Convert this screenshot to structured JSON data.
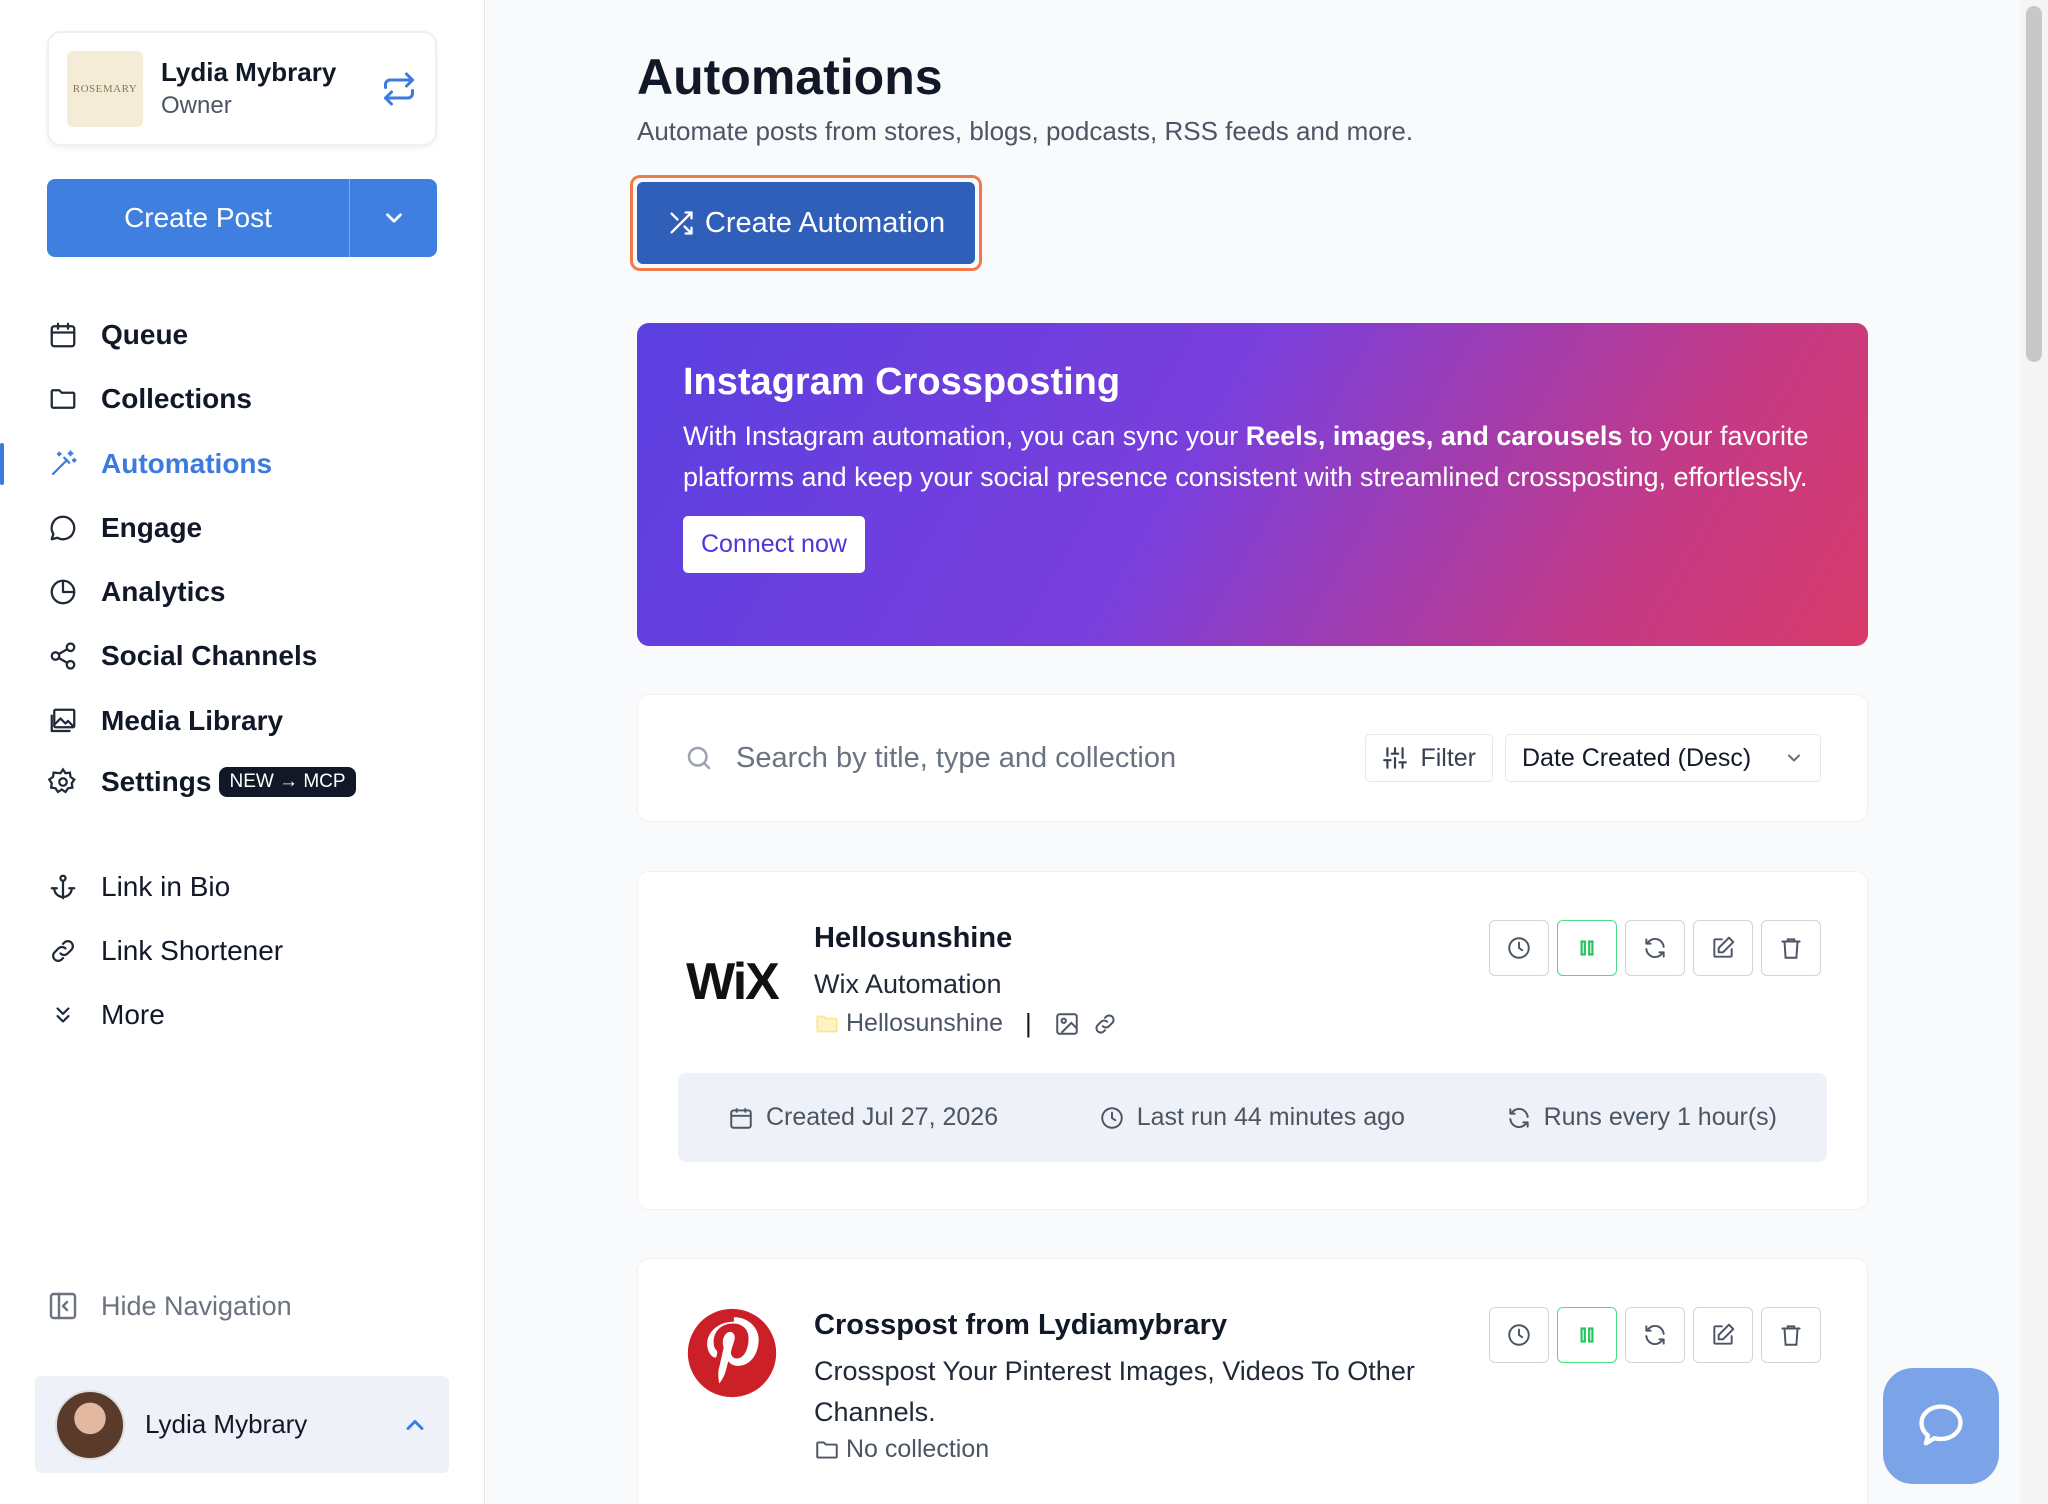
{
  "workspace": {
    "name": "Lydia Mybrary",
    "role": "Owner",
    "logo_text": "ROSEMARY"
  },
  "create_post": {
    "label": "Create Post"
  },
  "nav": {
    "primary": [
      {
        "label": "Queue",
        "icon": "calendar-icon"
      },
      {
        "label": "Collections",
        "icon": "folder-icon"
      },
      {
        "label": "Automations",
        "icon": "wand-icon",
        "active": true
      },
      {
        "label": "Engage",
        "icon": "chat-bubble-icon"
      },
      {
        "label": "Analytics",
        "icon": "pie-chart-icon"
      },
      {
        "label": "Social Channels",
        "icon": "share-icon"
      },
      {
        "label": "Media Library",
        "icon": "images-icon"
      },
      {
        "label": "Settings",
        "icon": "gear-icon",
        "badge": "NEW → MCP"
      }
    ],
    "secondary": [
      {
        "label": "Link in Bio",
        "icon": "anchor-icon"
      },
      {
        "label": "Link Shortener",
        "icon": "link-icon"
      },
      {
        "label": "More",
        "icon": "chevrons-down-icon"
      }
    ],
    "hide_label": "Hide Navigation"
  },
  "user": {
    "name": "Lydia Mybrary"
  },
  "page": {
    "title": "Automations",
    "subtitle": "Automate posts from stores, blogs, podcasts, RSS feeds and more.",
    "create_label": "Create Automation"
  },
  "promo": {
    "title": "Instagram Crossposting",
    "text_before": "With Instagram automation, you can sync your ",
    "text_bold": "Reels, images, and carousels",
    "text_after": " to your favorite platforms and keep your social presence consistent with streamlined crossposting, effortlessly.",
    "cta": "Connect now"
  },
  "search": {
    "placeholder": "Search by title, type and collection",
    "filter_label": "Filter",
    "sort_label": "Date Created (Desc)"
  },
  "automations": [
    {
      "title": "Hellosunshine",
      "description": "Wix Automation",
      "collection": "Hellosunshine",
      "logo": "wix-logo",
      "logo_text": "WiX",
      "created": "Created Jul 27, 2026",
      "last_run": "Last run 44 minutes ago",
      "frequency": "Runs every 1 hour(s)"
    },
    {
      "title": "Crosspost from Lydiamybrary",
      "description": "Crosspost Your Pinterest Images, Videos To Other Channels.",
      "collection": "No collection",
      "logo": "pinterest-logo"
    }
  ],
  "colors": {
    "accent": "#3b7be0",
    "primary_dark": "#2f5fb8",
    "highlight": "#f07a4a",
    "pause_green": "#22c55e"
  }
}
